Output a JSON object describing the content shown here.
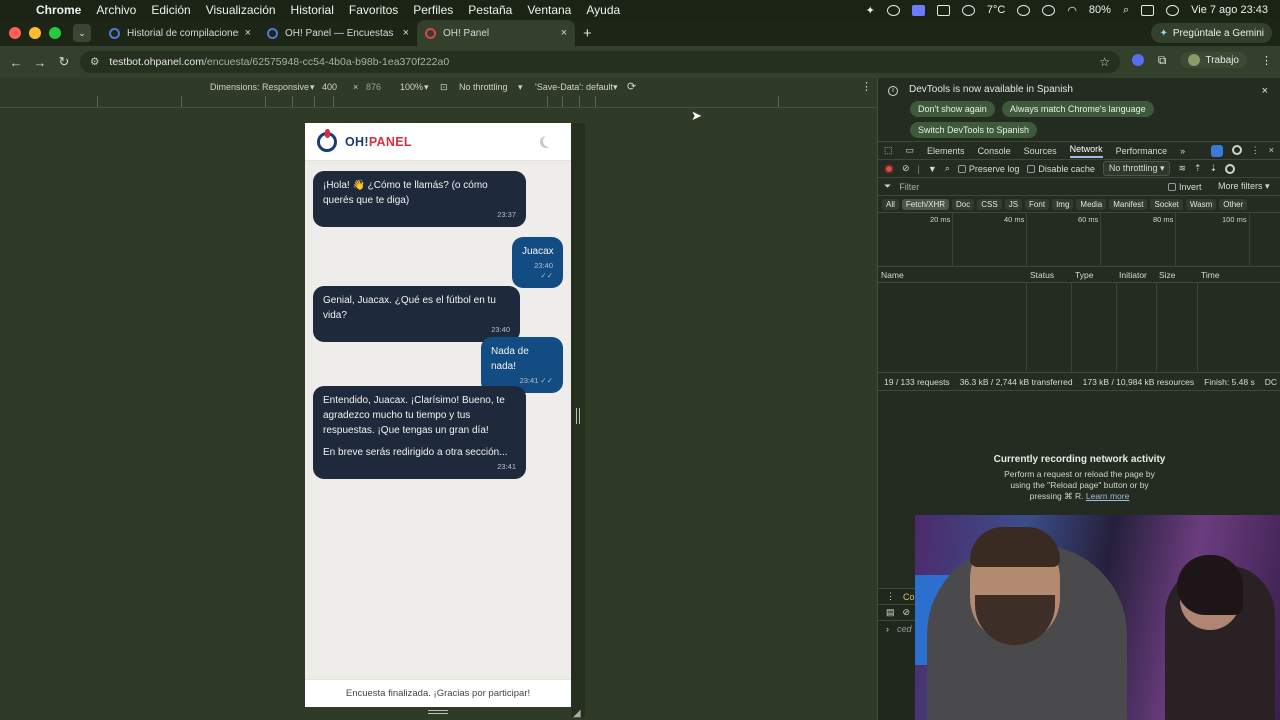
{
  "menubar": {
    "app": "Chrome",
    "items": [
      "Archivo",
      "Edición",
      "Visualización",
      "Historial",
      "Favoritos",
      "Perfiles",
      "Pestaña",
      "Ventana",
      "Ayuda"
    ],
    "weather": "7°C",
    "battery": "80%",
    "datetime": "Vie 7 ago  23:43"
  },
  "tabs": [
    {
      "title": "Historial de compilaciones – G",
      "close": "×"
    },
    {
      "title": "OH! Panel — Encuestas",
      "close": "×"
    },
    {
      "title": "OH! Panel",
      "close": "×"
    }
  ],
  "gemini_label": "Pregúntale a Gemini",
  "address": {
    "host": "testbot.ohpanel.com",
    "path": "/encuesta/62575948-cc54-4b0a-b98b-1ea370f222a0"
  },
  "profile_label": "Trabajo",
  "device_toolbar": {
    "dimensions_label": "Dimensions:",
    "mode": "Responsive",
    "width": "400",
    "x": "×",
    "height": "876",
    "zoom": "100%",
    "throttling": "No throttling",
    "save_data": "'Save-Data': default"
  },
  "chat": {
    "brand_prefix": "OH!",
    "brand_suffix": "PANEL",
    "messages": [
      {
        "role": "bot",
        "lines": [
          "¡Hola! 👋 ¿Cómo te llamás? (o cómo querés que te diga)"
        ],
        "time": "23:37"
      },
      {
        "role": "user",
        "lines": [
          "Juacax"
        ],
        "time": "23:40 ✓✓"
      },
      {
        "role": "bot",
        "lines": [
          "Genial, Juacax. ¿Qué es el fútbol en tu vida?"
        ],
        "time": "23:40"
      },
      {
        "role": "user",
        "lines": [
          "Nada de nada!"
        ],
        "time": "23:41 ✓✓"
      },
      {
        "role": "bot",
        "lines": [
          "Entendido, Juacax. ¡Clarísimo! Bueno, te agradezco mucho tu tiempo y tus respuestas. ¡Que tengas un gran día!",
          "En breve serás redirigido a otra sección..."
        ],
        "time": "23:41"
      }
    ],
    "footer": "Encuesta finalizada. ¡Gracias por participar!"
  },
  "devtools": {
    "banner_msg": "DevTools is now available in Spanish",
    "btn_dont_show": "Don't show again",
    "btn_match": "Always match Chrome's language",
    "btn_switch": "Switch DevTools to Spanish",
    "panels": [
      "Elements",
      "Console",
      "Sources",
      "Network",
      "Performance"
    ],
    "active_panel": "Network",
    "preserve_log": "Preserve log",
    "disable_cache": "Disable cache",
    "throttling": "No throttling",
    "filter_placeholder": "Filter",
    "invert": "Invert",
    "more_filters": "More filters",
    "chips": [
      "All",
      "Fetch/XHR",
      "Doc",
      "CSS",
      "JS",
      "Font",
      "Img",
      "Media",
      "Manifest",
      "Socket",
      "Wasm",
      "Other"
    ],
    "timeline_ticks": [
      "20 ms",
      "40 ms",
      "60 ms",
      "80 ms",
      "100 ms"
    ],
    "columns": [
      "Name",
      "Status",
      "Type",
      "Initiator",
      "Size",
      "Time"
    ],
    "summary": {
      "requests": "19 / 133 requests",
      "transferred": "36.3 kB / 2,744 kB transferred",
      "resources": "173 kB / 10,984 kB resources",
      "finish": "Finish: 5.48 s",
      "tail": "DC"
    },
    "recording_title": "Currently recording network activity",
    "recording_desc_1": "Perform a request or reload the page by",
    "recording_desc_2": "using the \"Reload page\" button or by",
    "recording_desc_3": "pressing ⌘ R.",
    "learn_more": "Learn more",
    "drawer_tab": "Cor",
    "drawer_input": "ced"
  },
  "colors": {
    "bot_bubble": "#1e2a3b",
    "user_bubble": "#134c83",
    "brand_blue": "#1c3a72",
    "brand_red": "#d6303d"
  }
}
